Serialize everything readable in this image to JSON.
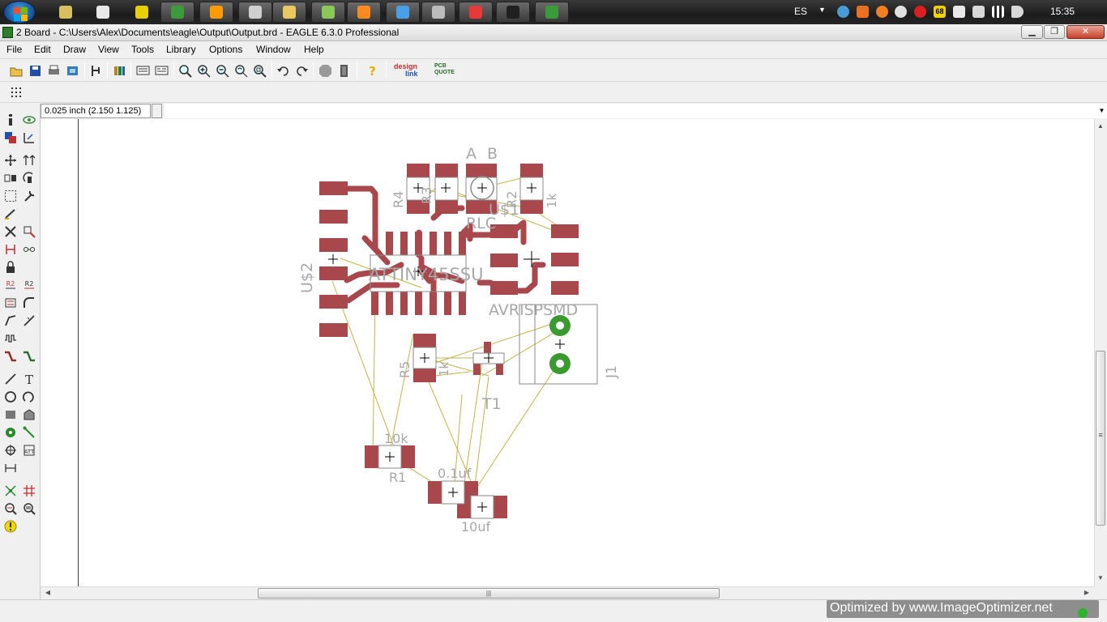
{
  "window": {
    "title": "2 Board - C:\\Users\\Alex\\Documents\\eagle\\Output\\Output.brd - EAGLE 6.3.0 Professional",
    "min_label": "▁",
    "max_label": "❐",
    "close_label": "✕"
  },
  "taskbar": {
    "language": "ES",
    "clock": "15:35",
    "tray_badge": "68",
    "apps": [
      {
        "name": "usb-tool-icon",
        "color": "#d8c060"
      },
      {
        "name": "calculator-icon",
        "color": "#e8e8e8"
      },
      {
        "name": "notepad-icon",
        "color": "#e6d000"
      },
      {
        "name": "chrome-icon",
        "color": "#3b9b3b"
      },
      {
        "name": "media-player-icon",
        "color": "#ff9a00"
      },
      {
        "name": "check-icon",
        "color": "#cfcfcf"
      },
      {
        "name": "explorer-icon",
        "color": "#e8c860"
      },
      {
        "name": "messenger-icon",
        "color": "#8ac858"
      },
      {
        "name": "illustrator-icon",
        "color": "#ff8a20"
      },
      {
        "name": "app-blue-icon",
        "color": "#4aa0e8"
      },
      {
        "name": "eagle-icon",
        "color": "#bcbcbc"
      },
      {
        "name": "app-red-icon",
        "color": "#e83838"
      },
      {
        "name": "app-circle-icon",
        "color": "#202020"
      },
      {
        "name": "chrome-icon",
        "color": "#3b9b3b"
      }
    ]
  },
  "menu": [
    "File",
    "Edit",
    "Draw",
    "View",
    "Tools",
    "Library",
    "Options",
    "Window",
    "Help"
  ],
  "toolbar": {
    "design_link_top": "design",
    "design_link_bottom": "link",
    "pcb_quote_top": "PCB",
    "pcb_quote_bottom": "QUOTE"
  },
  "command": {
    "coordinates": "0.025 inch (2.150 1.125)",
    "input_value": "",
    "drop_label": "▼"
  },
  "board": {
    "labels": {
      "a": "A",
      "b": "B",
      "r4": "R4",
      "r3": "R3",
      "r2": "R2",
      "r2_value": "1k",
      "rlc": "RLC",
      "us1": "U$1",
      "us2": "U$2",
      "chip": "ATTINY45SSU",
      "header": "AVRISPSMD",
      "j1": "J1",
      "r5": "R5",
      "r5_value": "1k",
      "t1": "T1",
      "r1_value": "10k",
      "r1": "R1",
      "c1_value": "0.1uf",
      "c2_value": "10uf"
    },
    "colors": {
      "pad": "#a8474c",
      "trace": "#a8474c",
      "via": "#3a9a30",
      "ratsnest": "#c2b44a",
      "silkscreen": "#a8a8a8",
      "outline": "#3c3c3c"
    }
  },
  "scroll": {
    "h_grip": "|||",
    "v_grip": "≡",
    "up": "▲",
    "down": "▼",
    "left": "◀",
    "right": "▶"
  },
  "watermark": "Optimized by www.ImageOptimizer.net"
}
